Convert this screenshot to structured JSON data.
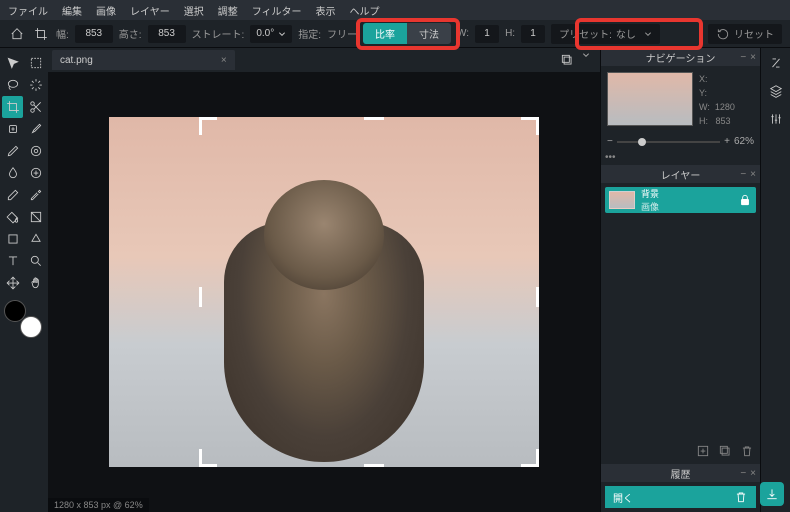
{
  "menu": {
    "file": "ファイル",
    "edit": "編集",
    "image": "画像",
    "layer": "レイヤー",
    "select": "選択",
    "adjust": "調整",
    "filter": "フィルター",
    "view": "表示",
    "help": "ヘルプ"
  },
  "toolbar": {
    "width_label": "幅:",
    "width": "853",
    "height_label": "高さ:",
    "height": "853",
    "straight_label": "ストレート:",
    "angle": "0.0°",
    "specify_label": "指定:",
    "free": "フリー",
    "ratio": "比率",
    "size": "寸法",
    "w_label": "W:",
    "w": "1",
    "h_label": "H:",
    "h": "1",
    "preset_label": "プリセット:",
    "preset_value": "なし",
    "reset": "リセット"
  },
  "tab": {
    "name": "cat.png"
  },
  "nav": {
    "title": "ナビゲーション",
    "x": "X:",
    "y": "Y:",
    "w": "W:",
    "wv": "1280",
    "h": "H:",
    "hv": "853",
    "zoom": "62%",
    "minus": "−",
    "plus": "+"
  },
  "layers": {
    "title": "レイヤー",
    "opts": "•••",
    "name": "背景",
    "sub": "画像"
  },
  "history": {
    "title": "履歴",
    "open": "開く"
  },
  "status": "1280 x 853 px @ 62%"
}
